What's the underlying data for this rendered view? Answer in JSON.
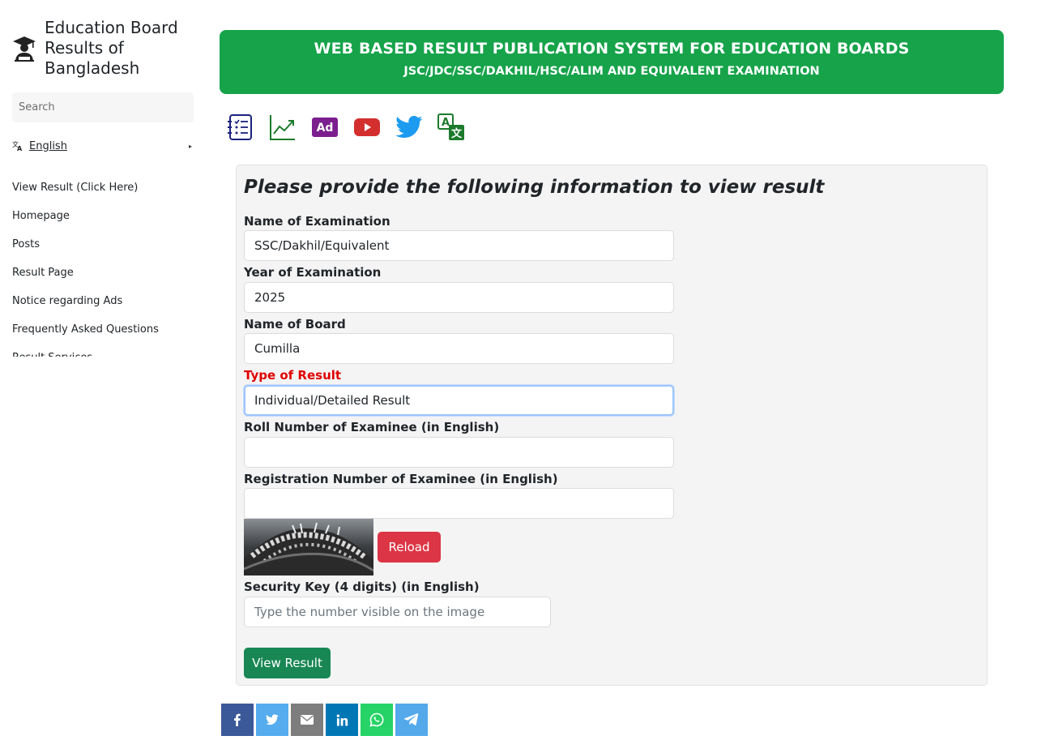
{
  "sidebar": {
    "brand_title": "Education Board Results of Bangladesh",
    "search_placeholder": "Search",
    "language": "English",
    "nav_items": [
      {
        "label": "View Result (Click Here)"
      },
      {
        "label": "Homepage"
      },
      {
        "label": "Posts"
      },
      {
        "label": "Result Page"
      },
      {
        "label": "Notice regarding Ads"
      },
      {
        "label": "Frequently Asked Questions"
      },
      {
        "label": "Result Services"
      }
    ]
  },
  "header": {
    "title": "WEB BASED RESULT PUBLICATION SYSTEM FOR EDUCATION BOARDS",
    "subtitle": "JSC/JDC/SSC/DAKHIL/HSC/ALIM AND EQUIVALENT EXAMINATION"
  },
  "toolbar": {
    "icons": [
      "list-icon",
      "trend-chart-icon",
      "ad-icon",
      "youtube-icon",
      "twitter-icon",
      "translate-icon"
    ],
    "ad_label": "Ad",
    "translate_label": "A"
  },
  "form": {
    "heading": "Please provide the following information to view result",
    "exam_label": "Name of Examination",
    "exam_value": "SSC/Dakhil/Equivalent",
    "year_label": "Year of Examination",
    "year_value": "2025",
    "board_label": "Name of Board",
    "board_value": "Cumilla",
    "type_label": "Type of Result",
    "type_value": "Individual/Detailed Result",
    "roll_label": "Roll Number of Examinee (in English)",
    "roll_value": "",
    "reg_label": "Registration Number of Examinee (in English)",
    "reg_value": "",
    "reload_label": "Reload",
    "key_label": "Security Key (4 digits) (in English)",
    "key_placeholder": "Type the number visible on the image",
    "submit_label": "View Result"
  },
  "share": {
    "buttons": [
      {
        "icon": "facebook-icon",
        "color": "#3b5998"
      },
      {
        "icon": "twitter-icon",
        "color": "#55acee"
      },
      {
        "icon": "email-icon",
        "color": "#7d7d7d"
      },
      {
        "icon": "linkedin-icon",
        "color": "#0077b5"
      },
      {
        "icon": "whatsapp-icon",
        "color": "#25d366"
      },
      {
        "icon": "telegram-icon",
        "color": "#54a9eb"
      }
    ]
  },
  "colors": {
    "banner": "#16a34a",
    "required_label": "#e00000",
    "reload": "#dc3545",
    "submit": "#198754"
  }
}
